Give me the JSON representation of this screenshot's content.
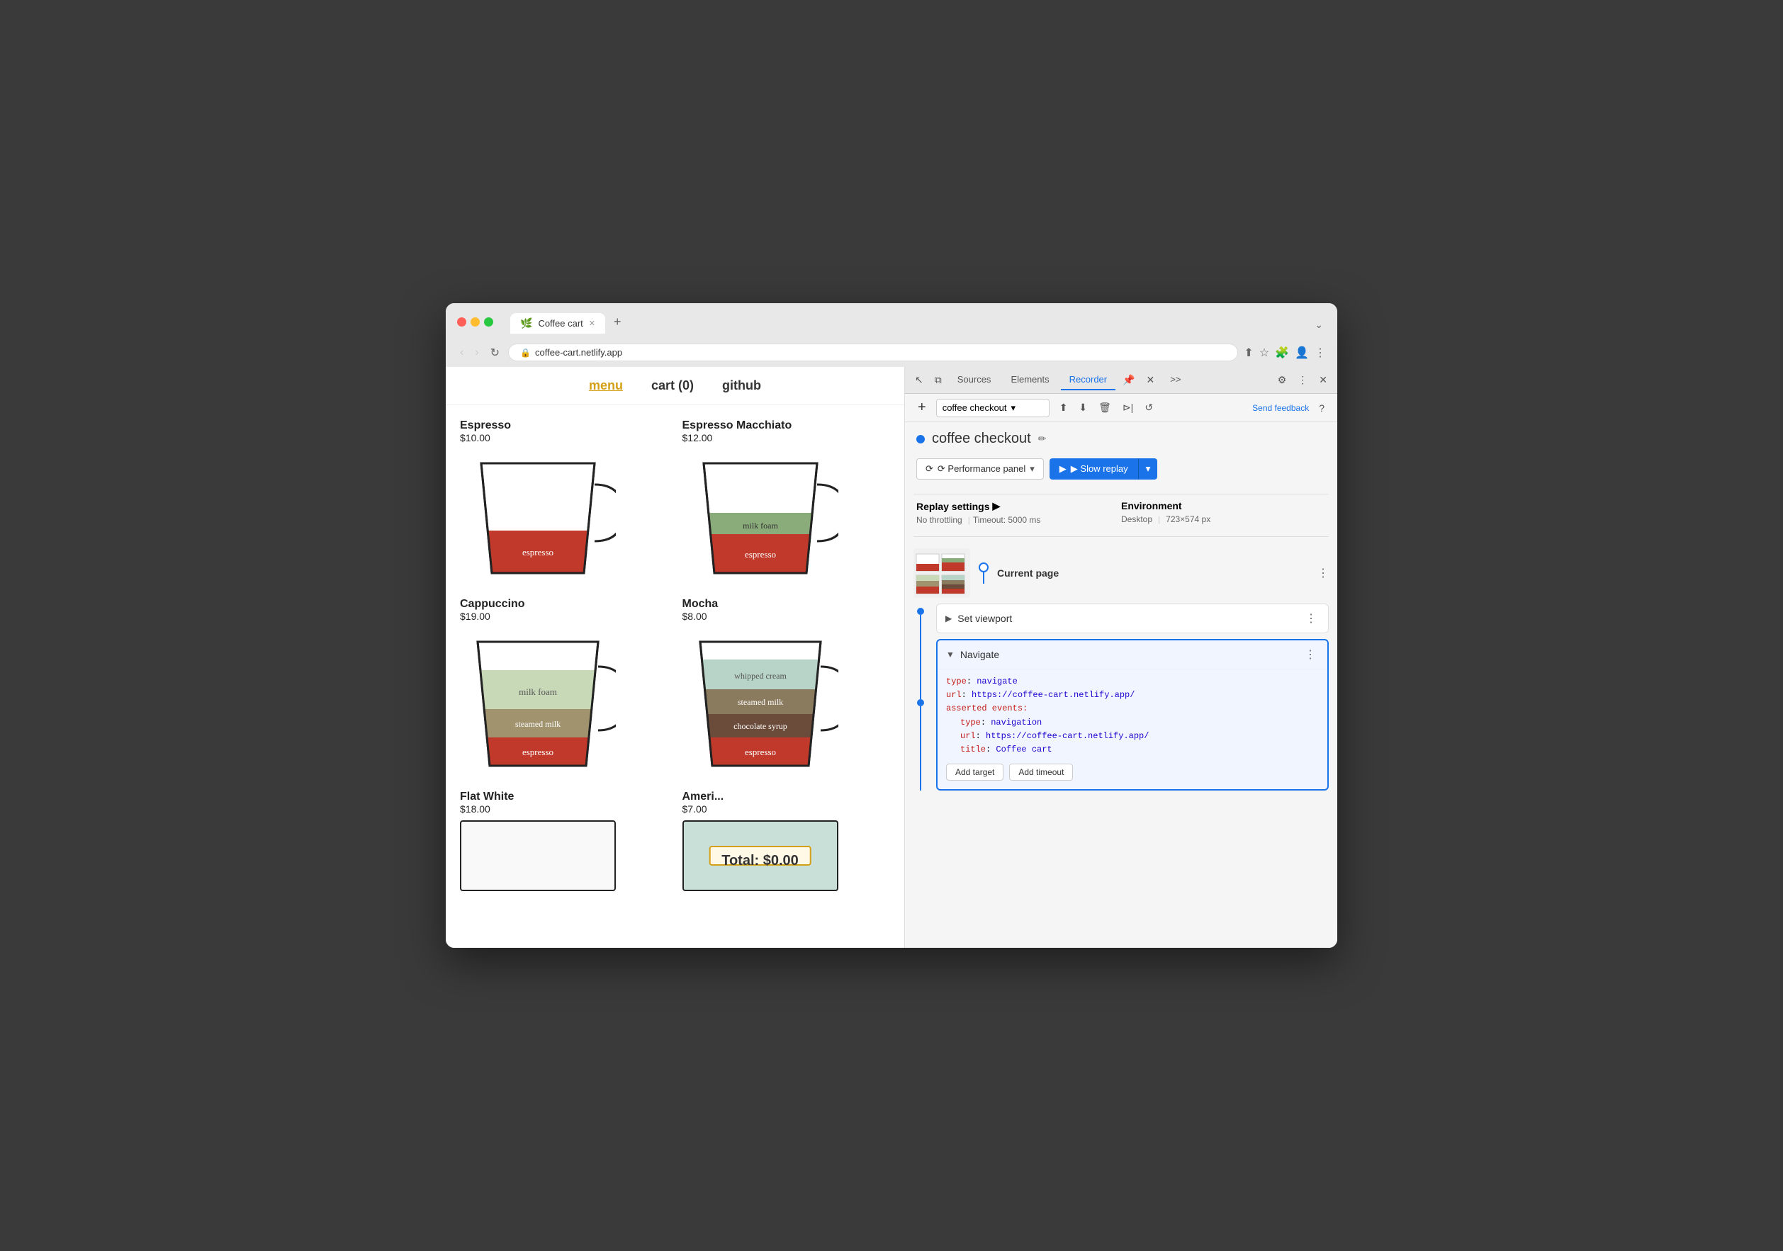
{
  "browser": {
    "url": "coffee-cart.netlify.app",
    "tab_title": "Coffee cart",
    "tab_icon": "🌿"
  },
  "site": {
    "nav": {
      "menu": "menu",
      "cart": "cart (0)",
      "github": "github"
    },
    "products": [
      {
        "name": "Espresso",
        "price": "$10.00",
        "layers": [
          {
            "label": "espresso",
            "color": "#c0392b",
            "height": 60
          }
        ]
      },
      {
        "name": "Espresso Macchiato",
        "price": "$12.00",
        "layers": [
          {
            "label": "milk foam",
            "color": "#8aab7a",
            "height": 40
          },
          {
            "label": "espresso",
            "color": "#c0392b",
            "height": 60
          }
        ]
      },
      {
        "name": "Cappuccino",
        "price": "$19.00",
        "layers": [
          {
            "label": "milk foam",
            "color": "#c8d9b8",
            "height": 55
          },
          {
            "label": "steamed milk",
            "color": "#a0936e",
            "height": 45
          },
          {
            "label": "espresso",
            "color": "#c0392b",
            "height": 50
          }
        ]
      },
      {
        "name": "Mocha",
        "price": "$8.00",
        "layers": [
          {
            "label": "whipped cream",
            "color": "#b8d4c8",
            "height": 45
          },
          {
            "label": "steamed milk",
            "color": "#8a7a5e",
            "height": 40
          },
          {
            "label": "chocolate syrup",
            "color": "#6b4c3a",
            "height": 35
          },
          {
            "label": "espresso",
            "color": "#c0392b",
            "height": 45
          }
        ]
      },
      {
        "name": "Flat White",
        "price": "$18.00",
        "layers": []
      },
      {
        "name": "Ameri...",
        "price": "$7.00",
        "layers": []
      }
    ],
    "total": "Total: $0.00"
  },
  "devtools": {
    "tabs": [
      "Sources",
      "Elements",
      "Recorder",
      ">>"
    ],
    "recorder_tab": "Recorder",
    "toolbar": {
      "add_btn": "+",
      "recording_name": "coffee checkout",
      "send_feedback": "Send feedback",
      "help": "?"
    },
    "recording": {
      "title": "coffee checkout",
      "dot_color": "#1a73e8",
      "edit_icon": "✏️",
      "perf_panel_btn": "⟳ Performance panel",
      "slow_replay_btn": "▶ Slow replay",
      "replay_settings": {
        "label": "Replay settings",
        "arrow": "▶",
        "throttling": "No throttling",
        "timeout": "Timeout: 5000 ms"
      },
      "environment": {
        "label": "Environment",
        "desktop": "Desktop",
        "resolution": "723×574 px"
      }
    },
    "current_page": {
      "label": "Current page",
      "more_icon": "⋮"
    },
    "steps": [
      {
        "id": "set-viewport",
        "label": "Set viewport",
        "expanded": false,
        "active": false
      },
      {
        "id": "navigate",
        "label": "Navigate",
        "expanded": true,
        "active": true,
        "code": {
          "type_key": "type",
          "type_val": "navigate",
          "url_key": "url",
          "url_val": "https://coffee-cart.netlify.app/",
          "asserted_events_key": "asserted events:",
          "nested_type_key": "type",
          "nested_type_val": "navigation",
          "nested_url_key": "url",
          "nested_url_val": "https://coffee-cart.netlify.app/",
          "title_key": "title",
          "title_val": "Coffee cart"
        },
        "actions": [
          "Add target",
          "Add timeout"
        ]
      }
    ]
  }
}
